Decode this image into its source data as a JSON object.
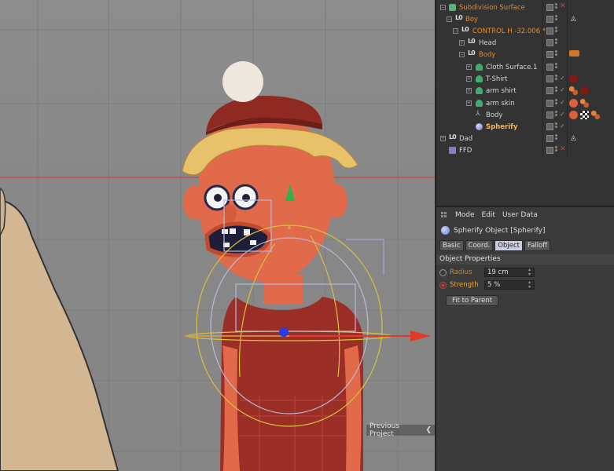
{
  "viewport": {
    "prev_project": "Previous Project"
  },
  "object_manager": {
    "rows": [
      {
        "name": "Subdivision Surface"
      },
      {
        "name": "Boy"
      },
      {
        "name": "CONTROL H -32.006 *"
      },
      {
        "name": "Head"
      },
      {
        "name": "Body"
      },
      {
        "name": "Cloth Surface.1"
      },
      {
        "name": "T-Shirt"
      },
      {
        "name": "arm shirt"
      },
      {
        "name": "arm skin"
      },
      {
        "name": "Body"
      },
      {
        "name": "Spherify"
      },
      {
        "name": "Dad"
      },
      {
        "name": "FFD"
      }
    ]
  },
  "attributes": {
    "menu": [
      "Mode",
      "Edit",
      "User Data"
    ],
    "title": "Spherify Object [Spherify]",
    "tabs": [
      "Basic",
      "Coord.",
      "Object",
      "Falloff"
    ],
    "active_tab": "Object",
    "section": "Object Properties",
    "params": [
      {
        "label": "Radius",
        "value": "19 cm"
      },
      {
        "label": "Strength",
        "value": "5 %"
      }
    ],
    "fit_button": "Fit to Parent"
  },
  "colors": {
    "accent_orange": "#e58b2a",
    "selected": "#ffb347",
    "axis_red": "#e03a28",
    "axis_green": "#2fb24a",
    "axis_blue": "#2a3be0",
    "viewport_bg": "#8a8a8a"
  }
}
